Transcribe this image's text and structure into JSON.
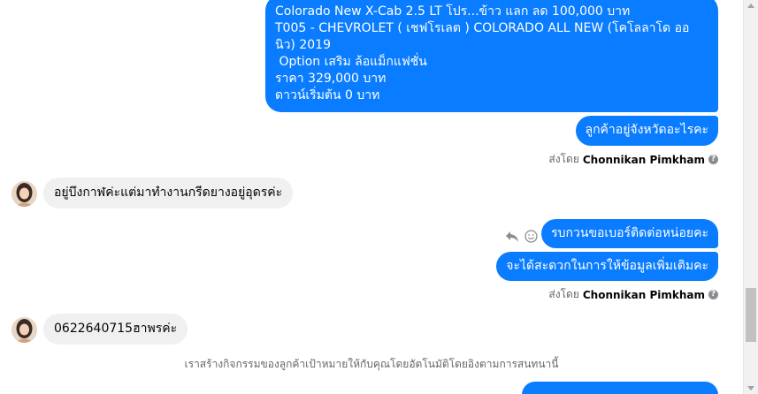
{
  "colors": {
    "outgoing_bubble": "#0a7cff",
    "incoming_bubble": "#f0f0f0",
    "meta_text": "#65676b"
  },
  "messages": {
    "product": {
      "line1": "Colorado New X-Cab 2.5 LT โปร...ข้าว แลก ลด 100,000 บาท",
      "line2": "T005 - CHEVROLET ( เชฟโรเลต ) COLORADO ALL NEW (โคโลลาโด ออนิว) 2019",
      "line3": "",
      "line4": " Option เสริม ล้อแม็กแฟชั่น",
      "line5": "ราคา 329,000 บาท",
      "line6": "ดาวน์เริ่มต้น 0 บาท"
    },
    "ask_province": "ลูกค้าอยู่จังหวัดอะไรคะ",
    "sent_by_1": {
      "prefix": "ส่งโดย",
      "name": "Chonnikan Pimkham"
    },
    "reply_province": "อยู่บึงกาฬค่ะแต่มาทำงานกรีดยางอยู่อุดรค่ะ",
    "ask_phone": "รบกวนขอเบอร์ติดต่อหน่อยคะ",
    "ask_info": "จะได้สะดวกในการให้ข้อมูลเพิ่มเติมคะ",
    "sent_by_2": {
      "prefix": "ส่งโดย",
      "name": "Chonnikan Pimkham"
    },
    "reply_phone": "0622640715ฮาพรค่ะ",
    "notice": "เราสร้างกิจกรรมของลูกค้าเป้าหมายให้กับคุณโดยอัตโนมัติโดยอิงตามการสนทนานี้"
  },
  "icons": {
    "reply": "reply-icon",
    "react": "smiley-icon",
    "info": "info-icon"
  }
}
